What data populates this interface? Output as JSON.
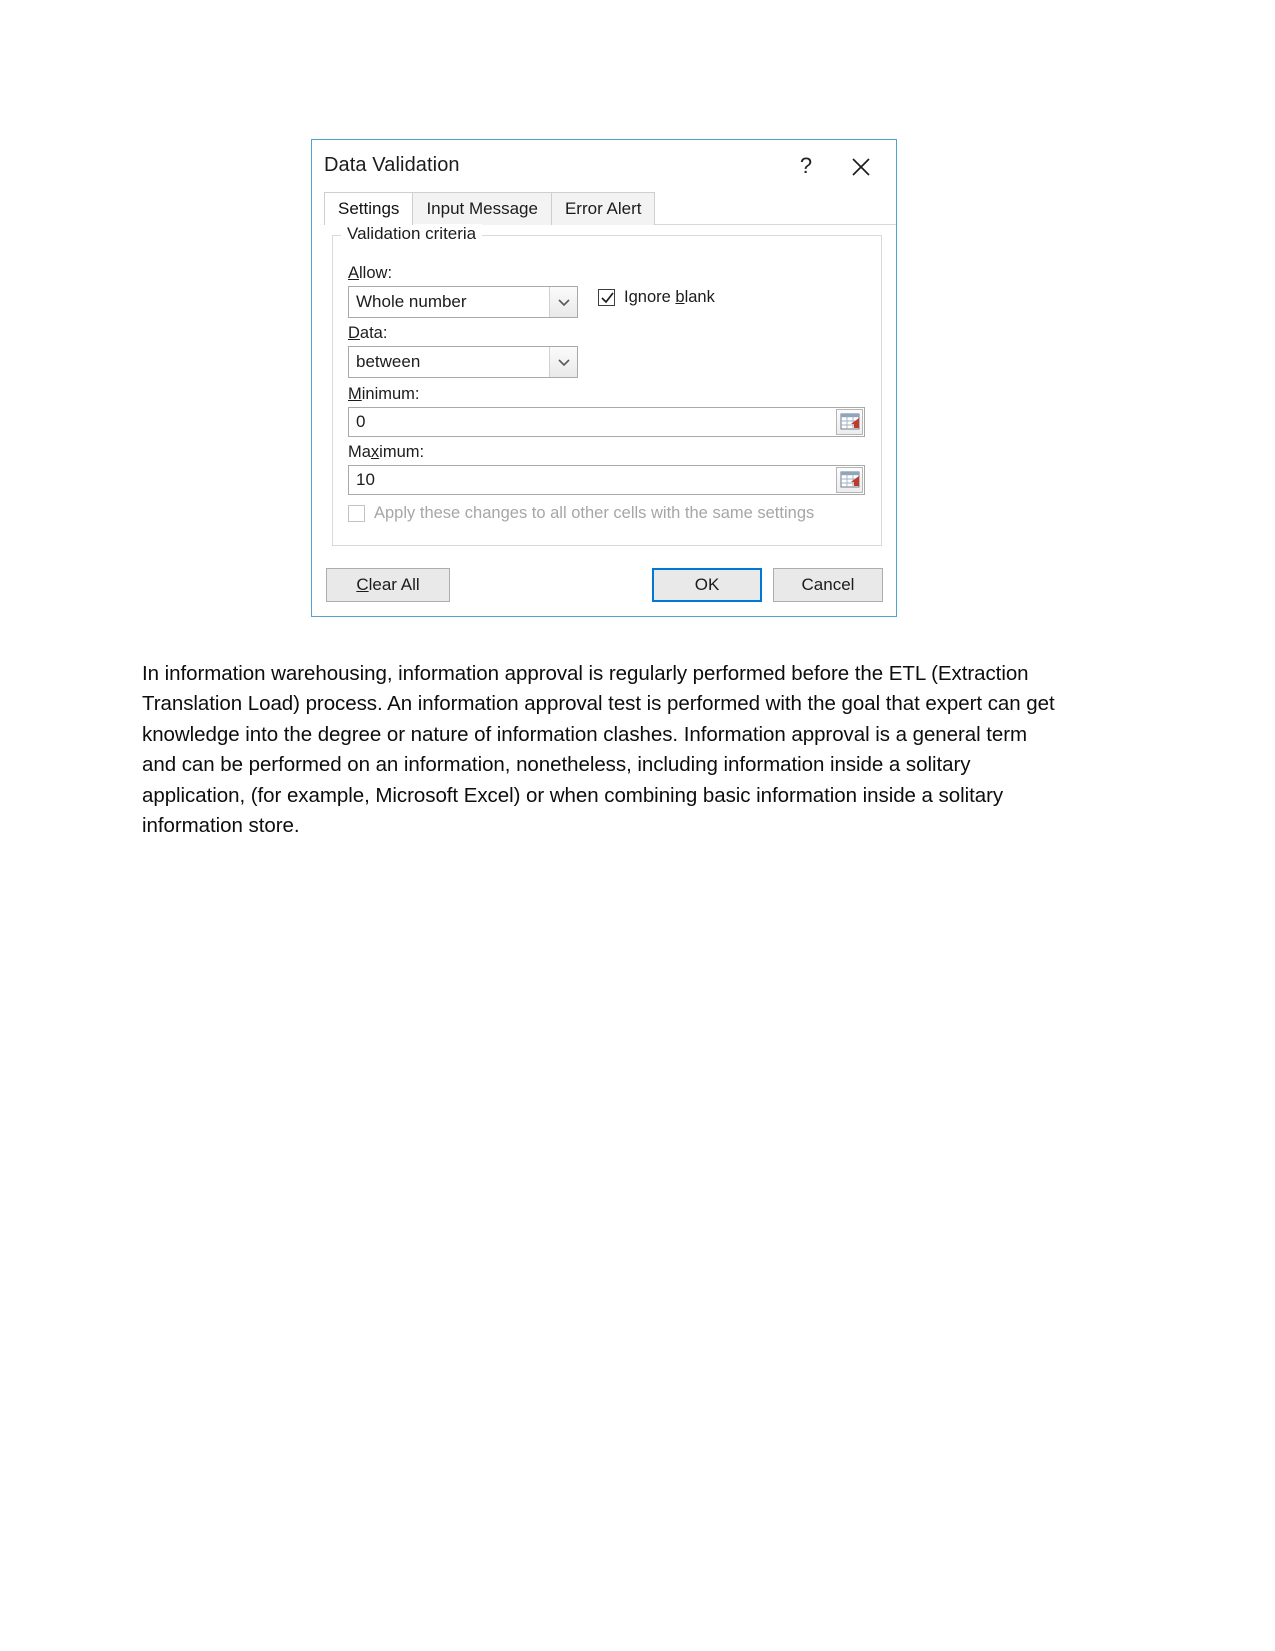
{
  "dialog": {
    "title": "Data Validation",
    "help_icon": "question-mark-icon",
    "close_icon": "close-icon",
    "tabs": [
      {
        "label": "Settings",
        "active": true
      },
      {
        "label": "Input Message",
        "active": false
      },
      {
        "label": "Error Alert",
        "active": false
      }
    ],
    "group_legend": "Validation criteria",
    "fields": {
      "allow": {
        "label_pre": "",
        "label_accel": "A",
        "label_post": "llow:",
        "value": "Whole number",
        "arrow_icon": "chevron-down-icon"
      },
      "data": {
        "label_accel": "D",
        "label_post": "ata:",
        "value": "between",
        "arrow_icon": "chevron-down-icon"
      },
      "minimum": {
        "label_accel": "M",
        "label_post": "inimum:",
        "value": "0",
        "picker_icon": "range-selector-icon"
      },
      "maximum": {
        "label_pre": "Ma",
        "label_accel": "x",
        "label_post": "imum:",
        "value": "10",
        "picker_icon": "range-selector-icon"
      }
    },
    "ignore_blank": {
      "label_pre": "I",
      "label_accel": "g",
      "label_mid": "nore ",
      "label_accel2": "b",
      "label_post": "lank",
      "checked": true
    },
    "apply_all": {
      "label": "Apply these changes to all other cells with the same settings",
      "checked": false,
      "disabled": true
    },
    "buttons": {
      "clear_all_accel": "C",
      "clear_all_post": "lear All",
      "ok": "OK",
      "cancel": "Cancel"
    },
    "colors": {
      "dialog_border": "#4fa3d1",
      "default_button_border": "#0078d7",
      "disabled_text": "#a6a6a6",
      "picker_arrow_red": "#c0392b"
    }
  },
  "document": {
    "paragraph": "In information warehousing, information approval is regularly performed before the ETL (Extraction Translation Load) process. An information approval test is performed with the goal that expert can get knowledge into the degree or nature of information clashes. Information approval is a general term and can be performed on an information, nonetheless, including information inside a solitary application, (for example, Microsoft Excel) or when combining basic information inside a solitary information store."
  }
}
